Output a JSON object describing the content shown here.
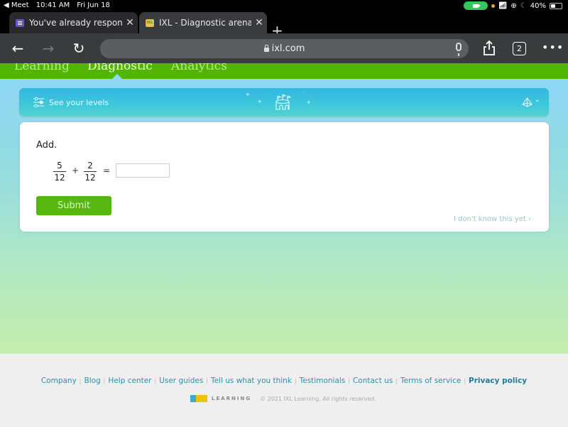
{
  "status_bar": {
    "back_app": "◀ Meet",
    "time": "10:41 AM",
    "date": "Fri Jun 18",
    "battery": "40%",
    "battery_level": 0.4
  },
  "browser": {
    "tabs": [
      {
        "title": "You've already responded",
        "active": false,
        "close_label": "✕"
      },
      {
        "title": "IXL - Diagnostic arena",
        "active": true,
        "close_label": "✕",
        "favicon_text": "IXL"
      }
    ],
    "new_tab_label": "+",
    "url": "ixl.com",
    "tab_count": "2",
    "more_label": "•••",
    "back_label": "←",
    "forward_label": "→",
    "reload_label": "↻"
  },
  "site_nav": {
    "items": [
      {
        "label": "Learning",
        "active": false
      },
      {
        "label": "Diagnostic",
        "active": true
      },
      {
        "label": "Analytics",
        "active": false
      }
    ]
  },
  "levels_bar": {
    "label": "See your levels",
    "chevron": "⌄"
  },
  "question": {
    "prompt": "Add.",
    "fraction1": {
      "numerator": "5",
      "denominator": "12"
    },
    "operator": "+",
    "equals": "=",
    "fraction2": {
      "numerator": "2",
      "denominator": "12"
    },
    "answer_value": "",
    "submit_label": "Submit",
    "idk_label": "I don't know this yet ›"
  },
  "footer": {
    "links": [
      {
        "label": "Company"
      },
      {
        "label": "Blog"
      },
      {
        "label": "Help center"
      },
      {
        "label": "User guides"
      },
      {
        "label": "Tell us what you think"
      },
      {
        "label": "Testimonials"
      },
      {
        "label": "Contact us"
      },
      {
        "label": "Terms of service"
      },
      {
        "label": "Privacy policy"
      }
    ],
    "separator": "|",
    "logo_word": "LEARNING",
    "copyright": "© 2021 IXL Learning. All rights reserved."
  },
  "colors": {
    "ixl_green": "#52b500",
    "submit_green": "#56b80e",
    "link_blue": "#2e8fa8",
    "levels_bar_top": "#34b5e2"
  }
}
